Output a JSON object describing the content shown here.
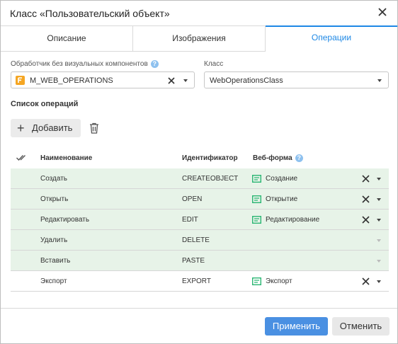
{
  "dialog": {
    "title": "Класс «Пользовательский объект»"
  },
  "tabs": [
    {
      "label": "Описание",
      "active": false
    },
    {
      "label": "Изображения",
      "active": false
    },
    {
      "label": "Операции",
      "active": true
    }
  ],
  "handler": {
    "label": "Обработчик без визуальных компонентов",
    "value": "M_WEB_OPERATIONS",
    "icon": "f-object-icon"
  },
  "class_field": {
    "label": "Класс",
    "value": "WebOperationsClass"
  },
  "operations": {
    "section_title": "Список операций",
    "add_label": "Добавить",
    "columns": {
      "name": "Наименование",
      "id": "Идентификатор",
      "form": "Веб-форма"
    },
    "rows": [
      {
        "name": "Создать",
        "id": "CREATEOBJECT",
        "form": "Создание",
        "selected": true
      },
      {
        "name": "Открыть",
        "id": "OPEN",
        "form": "Открытие",
        "selected": true
      },
      {
        "name": "Редактировать",
        "id": "EDIT",
        "form": "Редактирование",
        "selected": true
      },
      {
        "name": "Удалить",
        "id": "DELETE",
        "form": "",
        "selected": true
      },
      {
        "name": "Вставить",
        "id": "PASTE",
        "form": "",
        "selected": true
      },
      {
        "name": "Экспорт",
        "id": "EXPORT",
        "form": "Экспорт",
        "selected": false
      }
    ]
  },
  "footer": {
    "apply_label": "Применить",
    "cancel_label": "Отменить"
  },
  "colors": {
    "accent": "#1e88e5",
    "selected_row": "#e7f3e8",
    "apply_bg": "#4a90e2",
    "form_icon": "#2bb673"
  }
}
